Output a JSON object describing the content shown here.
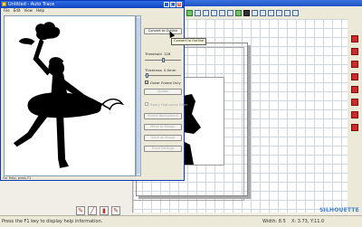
{
  "trace_window": {
    "title": "Untitled - Auto Trace",
    "menu": [
      "File",
      "Edit",
      "View",
      "Help"
    ],
    "status": "For Help, press F1"
  },
  "controls": {
    "convert_button": "Convert to Outline",
    "tooltip": "Convert to Outline",
    "threshold_label": "Threshold",
    "threshold_value": "128",
    "thickness_label": "Thickness",
    "thickness_value": "0.0mm",
    "outer_frame_label": "Outer Frame Only",
    "update_button": "Update",
    "filter_label": "Apply High-pass Filter",
    "button_a": "Rotate Background",
    "button_b": "Move to Design",
    "button_c": "Save as Image",
    "button_d": "Trace Settings"
  },
  "app": {
    "status_text": "Press the F1 key to display help information.",
    "size_readout": "Width: 8.5",
    "coords_readout": "X: 3.73, Y:11.0",
    "logo_text": "SILHOUETTE"
  },
  "colors": {
    "titlebar": "#1f53c5",
    "silhouette": "#000000",
    "accent_red": "#cc2b2b"
  }
}
